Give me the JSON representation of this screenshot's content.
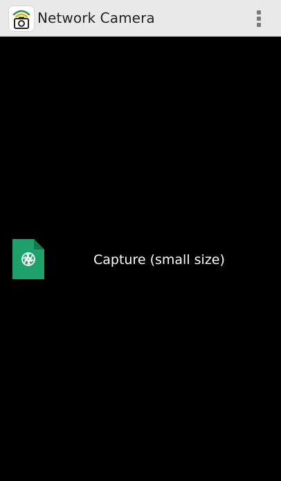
{
  "app_bar": {
    "title": "Network Camera",
    "app_icon": "wifi-camera-icon",
    "menu_icon": "overflow-menu-icon"
  },
  "list": {
    "items": [
      {
        "label": "Capture (small size)",
        "icon": "image-file-icon",
        "icon_color": "#1da26b"
      }
    ]
  },
  "colors": {
    "app_bar_bg": "#e9e9e9",
    "content_bg": "#000000",
    "accent_green": "#1da26b",
    "wifi_green": "#2f9a3b",
    "wifi_yellow": "#e8b500"
  }
}
